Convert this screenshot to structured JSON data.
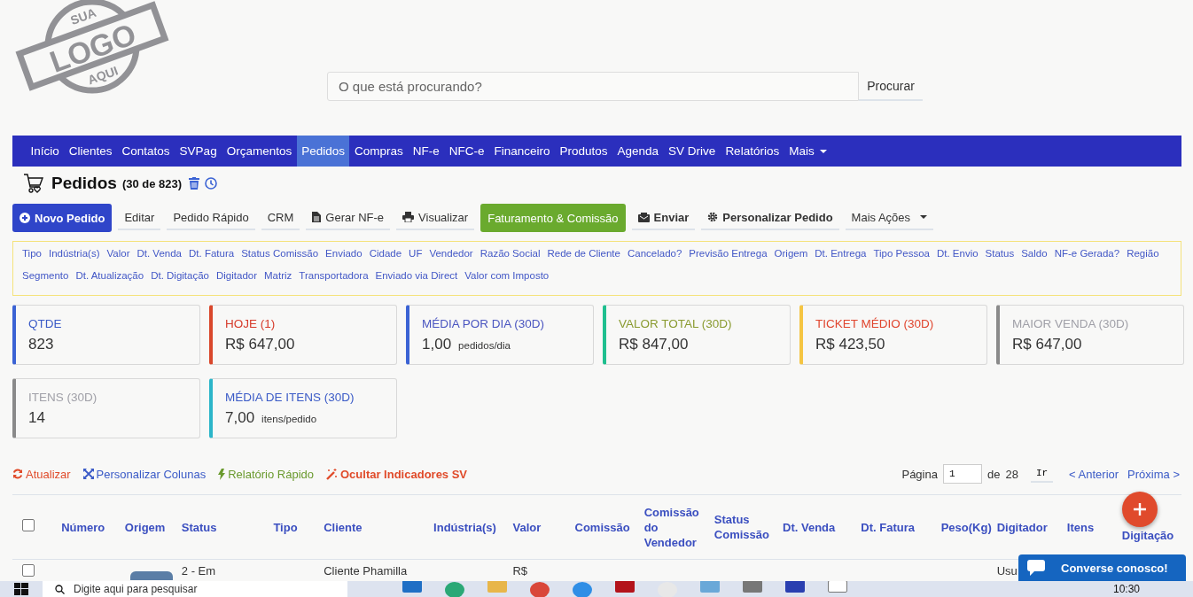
{
  "logo": {
    "top": "SUA",
    "main": "LOGO",
    "bottom": "AQUI"
  },
  "search": {
    "placeholder": "O que está procurando?",
    "button": "Procurar"
  },
  "nav": [
    {
      "label": "Início",
      "selected": false,
      "kind": "link"
    },
    {
      "label": "Clientes",
      "selected": false,
      "kind": "link"
    },
    {
      "label": "Contatos",
      "selected": false,
      "kind": "link"
    },
    {
      "label": "SVPag",
      "selected": false,
      "kind": "link"
    },
    {
      "label": "Orçamentos",
      "selected": false,
      "kind": "link"
    },
    {
      "label": "Pedidos",
      "selected": true,
      "kind": "link"
    },
    {
      "label": "Compras",
      "selected": false,
      "kind": "link"
    },
    {
      "label": "NF-e",
      "selected": false,
      "kind": "link"
    },
    {
      "label": "NFC-e",
      "selected": false,
      "kind": "link"
    },
    {
      "label": "Financeiro",
      "selected": false,
      "kind": "link"
    },
    {
      "label": "Produtos",
      "selected": false,
      "kind": "link"
    },
    {
      "label": "Agenda",
      "selected": false,
      "kind": "link"
    },
    {
      "label": "SV Drive",
      "selected": false,
      "kind": "link"
    },
    {
      "label": "Relatórios",
      "selected": false,
      "kind": "link"
    },
    {
      "label": "Mais",
      "selected": false,
      "kind": "dropdown"
    }
  ],
  "page_title": {
    "title": "Pedidos",
    "count": "(30 de 823)"
  },
  "actions": [
    {
      "label": "Novo Pedido",
      "kind": "new"
    },
    {
      "label": "Editar",
      "kind": "plain"
    },
    {
      "label": "Pedido Rápido",
      "kind": "plain"
    },
    {
      "label": "CRM",
      "kind": "plain"
    },
    {
      "label": "Gerar NF-e",
      "kind": "doc"
    },
    {
      "label": "Visualizar",
      "kind": "print"
    },
    {
      "label": "Faturamento & Comissão",
      "kind": "success"
    },
    {
      "label": "Enviar",
      "kind": "mail"
    },
    {
      "label": "Personalizar Pedido",
      "kind": "gear"
    },
    {
      "label": "Mais Ações",
      "kind": "dropdown"
    }
  ],
  "filters": [
    "Tipo",
    "Indústria(s)",
    "Valor",
    "Dt. Venda",
    "Dt. Fatura",
    "Status Comissão",
    "Enviado",
    "Cidade",
    "UF",
    "Vendedor",
    "Razão Social",
    "Rede de Cliente",
    "Cancelado?",
    "Previsão Entrega",
    "Origem",
    "Dt. Entrega",
    "Tipo Pessoa",
    "Dt. Envio",
    "Status",
    "Saldo",
    "NF-e Gerada?",
    "Região",
    "Segmento",
    "Dt. Atualização",
    "Dt. Digitação",
    "Digitador",
    "Matriz",
    "Transportadora",
    "Enviado via Direct",
    "Valor com Imposto"
  ],
  "cards": [
    {
      "label": {
        "text": "QTDE",
        "color": "#3b5bc7"
      },
      "value": "823",
      "color": "#3b63d4"
    },
    {
      "label": {
        "text": "HOJE (1)",
        "color": "#d63a2a"
      },
      "value": "R$ 647,00",
      "color": "#d9472b"
    },
    {
      "label": {
        "text": "MÉDIA POR DIA (30D)",
        "color": "#4a55c0"
      },
      "value": "1,00",
      "unit": "pedidos/dia",
      "color": "#3b63d4"
    },
    {
      "label": {
        "text": "VALOR TOTAL (30D)",
        "color": "#8a9b30"
      },
      "value": "R$ 847,00",
      "color": "#1fbf8f"
    },
    {
      "label": {
        "text": "TICKET MÉDIO (30D)",
        "color": "#e0452e"
      },
      "value": "R$ 423,50",
      "color": "#f5c542"
    },
    {
      "label": {
        "text": "MAIOR VENDA (30D)",
        "color": "#a0a0a8"
      },
      "value": "R$ 647,00",
      "color": "#8a8a8a"
    },
    {
      "label": {
        "text": "ITENS (30D)",
        "color": "#a0a0a8"
      },
      "value": "14",
      "color": "#8a8a8a"
    },
    {
      "label": {
        "text": "MÉDIA DE ITENS (30D)",
        "color": "#3b5bc7"
      },
      "value": "7,00",
      "unit": "itens/pedido",
      "color": "#2bb5c9"
    }
  ],
  "list_tools": [
    {
      "label": "Atualizar",
      "kind": "refresh",
      "color": "#e04b2a"
    },
    {
      "label": "Personalizar Colunas",
      "kind": "expand",
      "color": "#3b5bc7"
    },
    {
      "label": "Relatório Rápido",
      "kind": "bolt",
      "color": "#6a9a2e"
    },
    {
      "label": "Ocultar Indicadores SV",
      "kind": "wand",
      "color": "#e04b2a"
    }
  ],
  "pagination": {
    "label": "Página",
    "value": "1",
    "of": "de",
    "total": "28",
    "go": "Ir",
    "prev": "< Anterior",
    "next": "Próxima >"
  },
  "table": {
    "select_all": {
      "checked": false
    },
    "columns": [
      "Número",
      "Origem",
      "Status",
      "Tipo",
      "Cliente",
      "Indústria(s)",
      "Valor",
      "Comissão",
      "Comissão do Vendedor",
      "Status Comissão",
      "Dt. Venda",
      "Dt. Fatura",
      "Peso(Kg)",
      "Digitador",
      "Itens",
      "Digitação"
    ],
    "rows": [
      {
        "checked": false,
        "cells": [
          "",
          "",
          "2 - Em",
          "",
          "Cliente Phamilla",
          "",
          "R$",
          "",
          "",
          "",
          "",
          "",
          "",
          "Usu",
          "",
          ""
        ]
      }
    ]
  },
  "chat": {
    "label": "Converse conosco!"
  },
  "taskbar": {
    "search": "Digite aqui para pesquisar",
    "time": "10:30"
  }
}
